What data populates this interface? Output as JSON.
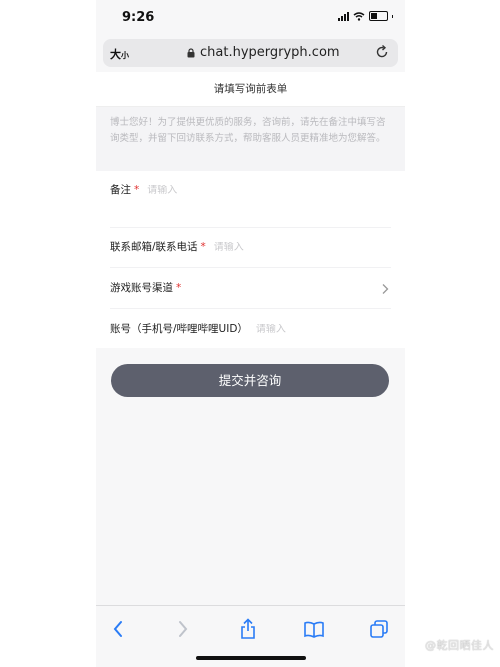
{
  "status_bar": {
    "time": "9:26"
  },
  "browser": {
    "text_size_label_big": "大",
    "text_size_label_small": "小",
    "url": "chat.hypergryph.com"
  },
  "form": {
    "title": "请填写询前表单",
    "notice": "博士您好！为了提供更优质的服务，咨询前，请先在备注中填写咨询类型，并留下回访联系方式，帮助客服人员更精准地为您解答。",
    "fields": [
      {
        "label": "备注",
        "required": "*",
        "placeholder": "请输入"
      },
      {
        "label": "联系邮箱/联系电话",
        "required": "*",
        "placeholder": "请输入"
      },
      {
        "label": "游戏账号渠道",
        "required": "*"
      },
      {
        "label": "账号（手机号/哔哩哔哩UID）",
        "placeholder": "请输入"
      }
    ],
    "submit_label": "提交并咨询"
  },
  "toolbar": {
    "icons": [
      "back-icon",
      "forward-icon",
      "share-icon",
      "bookmarks-icon",
      "tabs-icon"
    ]
  },
  "watermark": "@乾回晒佳人",
  "colors": {
    "accent_button": "#5d606d",
    "required_mark": "#e0302f",
    "link_blue": "#2a7cf6"
  }
}
